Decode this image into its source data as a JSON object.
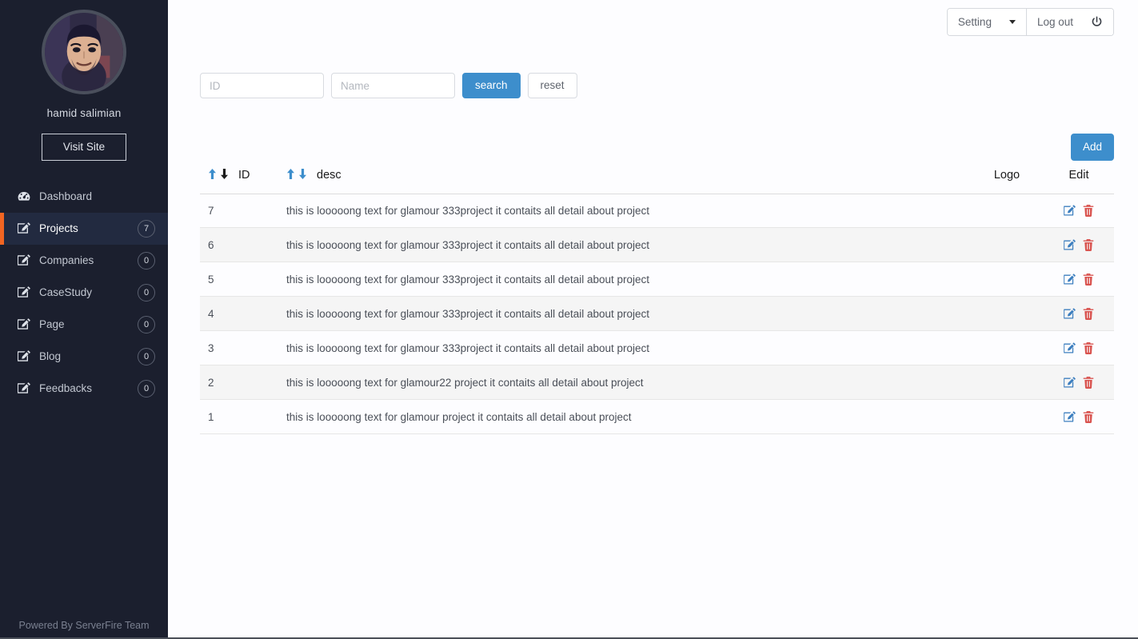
{
  "sidebar": {
    "user_name": "hamid salimian",
    "visit_site_label": "Visit Site",
    "avatar_icon": "user-avatar-photo",
    "footer_text": "Powered By ServerFire Team",
    "items": [
      {
        "label": "Dashboard",
        "icon": "dashboard-gauge-icon",
        "badge": "",
        "active": false
      },
      {
        "label": "Projects",
        "icon": "edit-square-icon",
        "badge": "7",
        "active": true
      },
      {
        "label": "Companies",
        "icon": "edit-square-icon",
        "badge": "0",
        "active": false
      },
      {
        "label": "CaseStudy",
        "icon": "edit-square-icon",
        "badge": "0",
        "active": false
      },
      {
        "label": "Page",
        "icon": "edit-square-icon",
        "badge": "0",
        "active": false
      },
      {
        "label": "Blog",
        "icon": "edit-square-icon",
        "badge": "0",
        "active": false
      },
      {
        "label": "Feedbacks",
        "icon": "edit-square-icon",
        "badge": "0",
        "active": false
      }
    ]
  },
  "topbar": {
    "setting_label": "Setting",
    "setting_caret_icon": "chevron-down-icon",
    "logout_label": "Log out",
    "logout_icon": "power-icon"
  },
  "search": {
    "id_value": "",
    "id_placeholder": "ID",
    "name_value": "",
    "name_placeholder": "Name",
    "search_label": "search",
    "reset_label": "reset"
  },
  "toolbar": {
    "add_label": "Add"
  },
  "table": {
    "columns": {
      "id": "ID",
      "desc": "desc",
      "logo": "Logo",
      "edit": "Edit"
    },
    "sort_icons": {
      "id_up": "sort-arrow-up-icon",
      "id_down": "sort-arrow-down-icon",
      "desc_up": "sort-arrow-up-icon",
      "desc_down": "sort-arrow-down-icon"
    },
    "row_actions": {
      "edit_icon": "edit-pencil-icon",
      "delete_icon": "trash-icon"
    },
    "rows": [
      {
        "id": "7",
        "desc": "this is looooong text for glamour 333project it contaits all detail about project",
        "logo": ""
      },
      {
        "id": "6",
        "desc": "this is looooong text for glamour 333project it contaits all detail about project",
        "logo": ""
      },
      {
        "id": "5",
        "desc": "this is looooong text for glamour 333project it contaits all detail about project",
        "logo": ""
      },
      {
        "id": "4",
        "desc": "this is looooong text for glamour 333project it contaits all detail about project",
        "logo": ""
      },
      {
        "id": "3",
        "desc": "this is looooong text for glamour 333project it contaits all detail about project",
        "logo": ""
      },
      {
        "id": "2",
        "desc": "this is looooong text for glamour22 project it contaits all detail about project",
        "logo": ""
      },
      {
        "id": "1",
        "desc": "this is looooong text for glamour project it contaits all detail about project",
        "logo": ""
      }
    ]
  },
  "colors": {
    "sidebar_bg": "#1b1f2e",
    "sidebar_active_bg": "#222a40",
    "accent_orange": "#f26522",
    "primary_blue": "#3d8ecc",
    "danger_red": "#d9534f",
    "row_stripe": "#f5f5f5"
  }
}
